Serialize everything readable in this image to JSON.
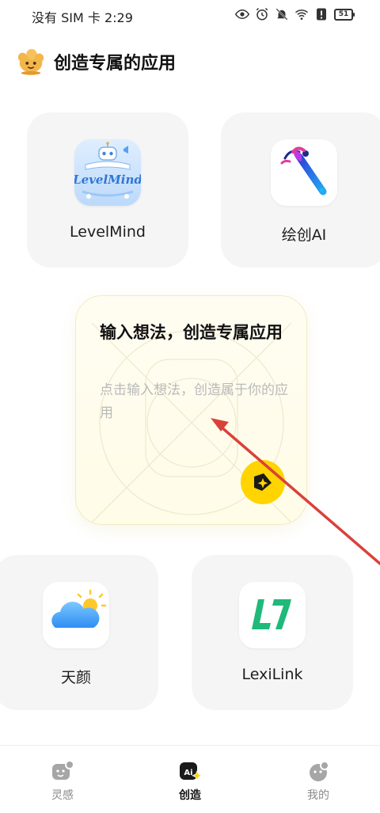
{
  "status_bar": {
    "left_text": "没有 SIM 卡 2:29",
    "battery": "51"
  },
  "header": {
    "title": "创造专属的应用"
  },
  "apps": [
    {
      "name": "LevelMind",
      "icon": "levelmind-app-icon",
      "icon_text": "LevelMind"
    },
    {
      "name": "绘创AI",
      "icon": "paintbrush-app-icon"
    },
    {
      "name": "天颜",
      "icon": "weather-cloud-sun-app-icon"
    },
    {
      "name": "LexiLink",
      "icon": "lexilink-app-icon"
    }
  ],
  "create_card": {
    "title": "输入想法，创造专属应用",
    "hint": "点击输入想法，创造属于你的应用",
    "button_icon": "create-sparkle-icon",
    "accent_color": "#ffd400"
  },
  "annotation": {
    "color": "#d9413b"
  },
  "bottom_nav": {
    "items": [
      {
        "label": "灵感",
        "icon": "inspiration-icon",
        "active": false
      },
      {
        "label": "创造",
        "icon": "ai-create-icon",
        "active": true
      },
      {
        "label": "我的",
        "icon": "profile-icon",
        "active": false
      }
    ]
  }
}
